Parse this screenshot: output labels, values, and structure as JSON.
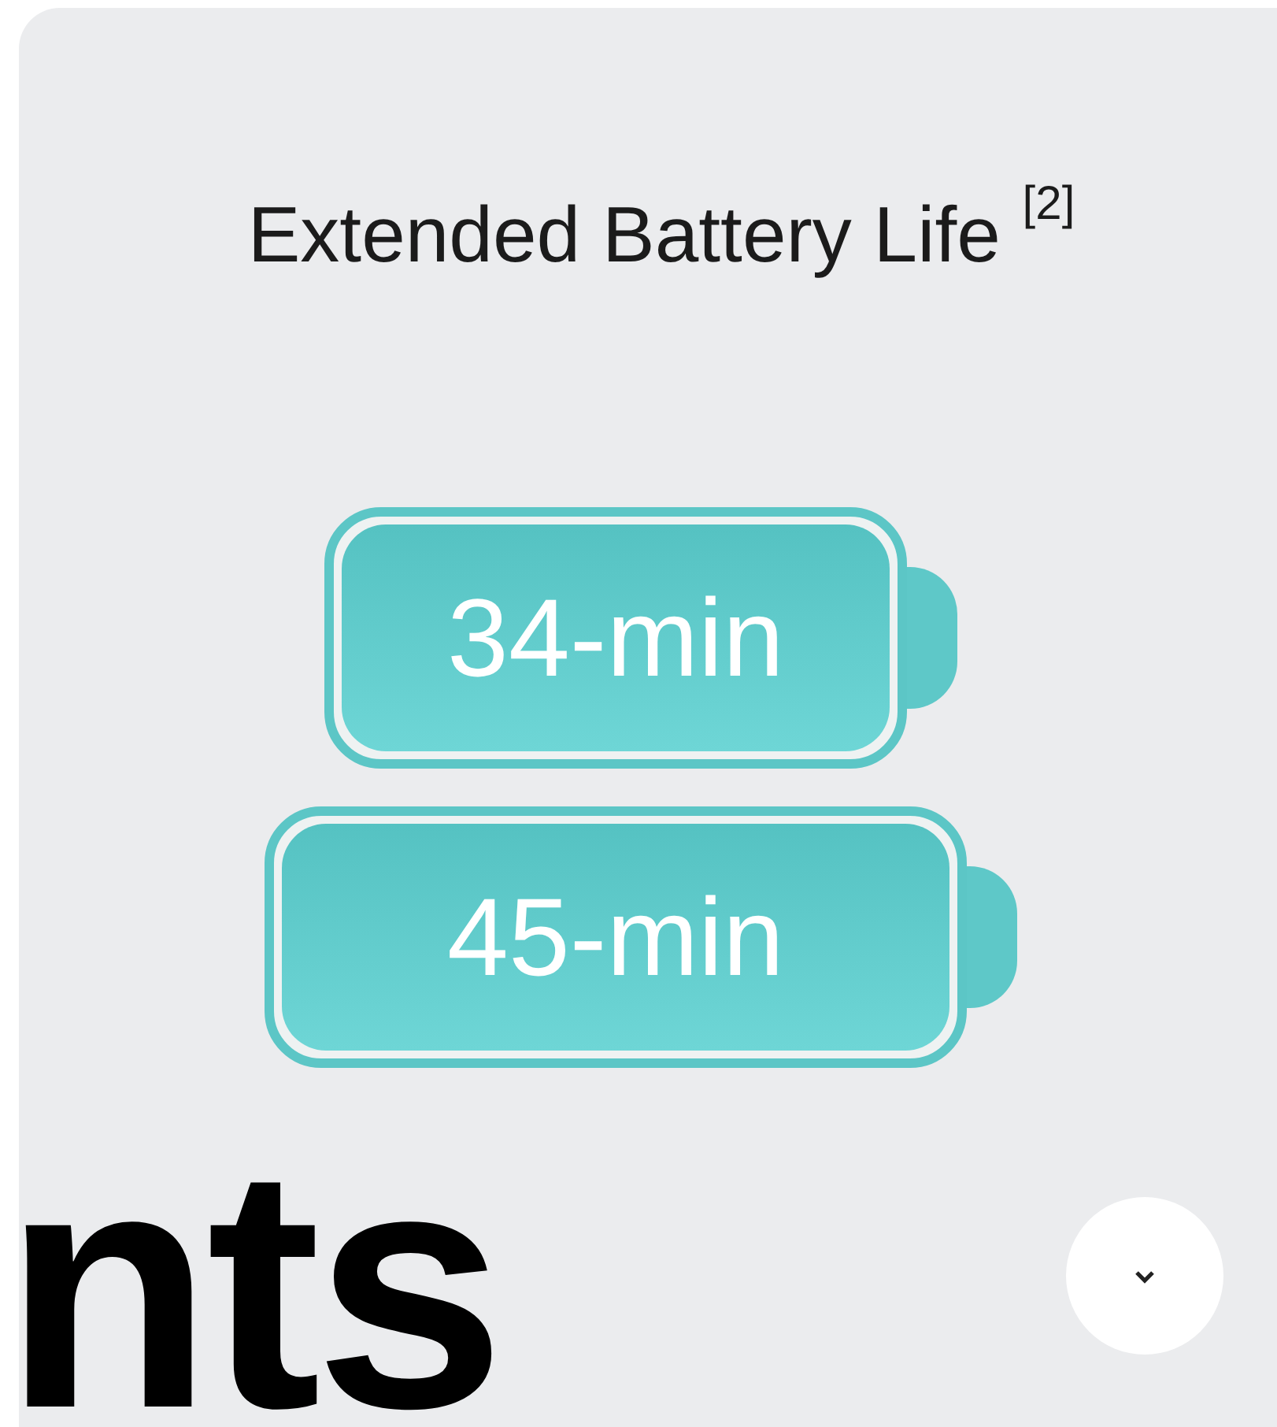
{
  "card": {
    "title": "Extended Battery Life $^{[2]}$",
    "batteries": [
      {
        "label": "34-min"
      },
      {
        "label": "45-min"
      }
    ],
    "expand_button": {
      "expanded": false
    }
  },
  "heading": "nts"
}
